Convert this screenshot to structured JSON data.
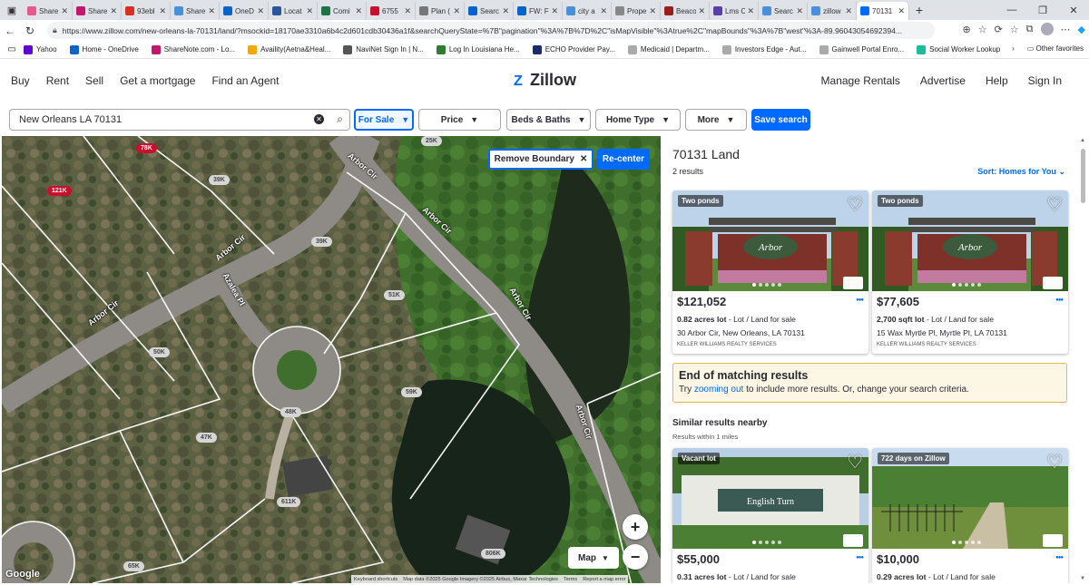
{
  "browser": {
    "tabs": [
      {
        "label": "Share",
        "color": "#e35a8c"
      },
      {
        "label": "Share",
        "color": "#c2186b"
      },
      {
        "label": "93ebl",
        "color": "#d93025"
      },
      {
        "label": "Share",
        "color": "#4a90d9"
      },
      {
        "label": "OneD",
        "color": "#0a64c8"
      },
      {
        "label": "Locat",
        "color": "#2b579a"
      },
      {
        "label": "Comi",
        "color": "#217346"
      },
      {
        "label": "6755",
        "color": "#c8102e"
      },
      {
        "label": "Plan (",
        "color": "#777777"
      },
      {
        "label": "Searc",
        "color": "#0a64c8"
      },
      {
        "label": "FW: F",
        "color": "#0a64c8"
      },
      {
        "label": "city a",
        "color": "#4a90d9"
      },
      {
        "label": "Prope",
        "color": "#888888"
      },
      {
        "label": "Beaco",
        "color": "#9b1c1c"
      },
      {
        "label": "Lms C",
        "color": "#5b3fa8"
      },
      {
        "label": "Searc",
        "color": "#4a90d9"
      },
      {
        "label": "zillow",
        "color": "#4a90d9"
      },
      {
        "label": "70131",
        "color": "#006aff",
        "active": true
      }
    ],
    "url": "https://www.zillow.com/new-orleans-la-70131/land/?msockid=18170ae3310a6b4c2d601cdb30436a1f&searchQueryState=%7B\"pagination\"%3A%7B%7D%2C\"isMapVisible\"%3Atrue%2C\"mapBounds\"%3A%7B\"west\"%3A-89.96043054692394...",
    "bookmarks": [
      {
        "label": "Yahoo",
        "color": "#6001d2"
      },
      {
        "label": "Home - OneDrive",
        "color": "#0a64c8"
      },
      {
        "label": "ShareNote.com - Lo...",
        "color": "#c2186b"
      },
      {
        "label": "Availity(Aetna&Heal...",
        "color": "#f2a900"
      },
      {
        "label": "NaviNet Sign In | N...",
        "color": "#555555"
      },
      {
        "label": "Log In Louisiana He...",
        "color": "#2e7d32"
      },
      {
        "label": "ECHO Provider Pay...",
        "color": "#1a2a6c"
      },
      {
        "label": "Medicaid | Departm...",
        "color": "#aaaaaa"
      },
      {
        "label": "Investors Edge - Aut...",
        "color": "#aaaaaa"
      },
      {
        "label": "Gainwell Portal Enro...",
        "color": "#aaaaaa"
      },
      {
        "label": "Social Worker Lookup",
        "color": "#1abc9c"
      }
    ],
    "other_favorites": "Other favorites"
  },
  "header": {
    "left_nav": [
      "Buy",
      "Rent",
      "Sell",
      "Get a mortgage",
      "Find an Agent"
    ],
    "logo": "Zillow",
    "right_nav": [
      "Manage Rentals",
      "Advertise",
      "Help",
      "Sign In"
    ]
  },
  "filters": {
    "search_value": "New Orleans LA 70131",
    "for_sale": "For Sale",
    "price": "Price",
    "beds_baths": "Beds & Baths",
    "home_type": "Home Type",
    "more": "More",
    "save_search": "Save search"
  },
  "map": {
    "remove_boundary": "Remove Boundary",
    "recenter": "Re-center",
    "map_type": "Map",
    "google": "Google",
    "attribution": [
      "Keyboard shortcuts",
      "Map data ©2025 Google Imagery ©2025 Airbus, Maxar Technologies",
      "Terms",
      "Report a map error"
    ],
    "street_labels": [
      "Arbor Cir",
      "Arbor Cir",
      "Arbor Cir",
      "Arbor Cir",
      "Arbor Cir",
      "Azalea Pl",
      "Arbor Cir"
    ],
    "price_pills": [
      "78K",
      "121K",
      "25K",
      "39K",
      "39K",
      "51K",
      "50K",
      "59K",
      "48K",
      "47K",
      "611K",
      "806K",
      "65K"
    ]
  },
  "results": {
    "title": "70131 Land",
    "count": "2 results",
    "sort": "Sort: Homes for You",
    "listings": [
      {
        "badge": "Two ponds",
        "price": "$121,052",
        "size": "0.82 acres lot",
        "type": "- Lot / Land for sale",
        "address": "30 Arbor Cir, New Orleans, LA 70131",
        "broker": "KELLER WILLIAMS REALTY SERVICES"
      },
      {
        "badge": "Two ponds",
        "price": "$77,605",
        "size": "2,700 sqft lot",
        "type": "- Lot / Land for sale",
        "address": "15 Wax Myrtle Pl, Myrtle Pl, LA 70131",
        "broker": "KELLER WILLIAMS REALTY SERVICES"
      }
    ],
    "end_title": "End of matching results",
    "end_pre": "Try ",
    "end_link": "zooming out",
    "end_post": " to include more results. Or, change your search criteria.",
    "similar_title": "Similar results nearby",
    "similar_sub": "Results within 1 miles",
    "similar": [
      {
        "badge": "Vacant lot",
        "price": "$55,000",
        "size": "0.31 acres lot",
        "type": "- Lot / Land for sale"
      },
      {
        "badge": "722 days on Zillow",
        "price": "$10,000",
        "size": "0.29 acres lot",
        "type": "- Lot / Land for sale"
      }
    ]
  }
}
